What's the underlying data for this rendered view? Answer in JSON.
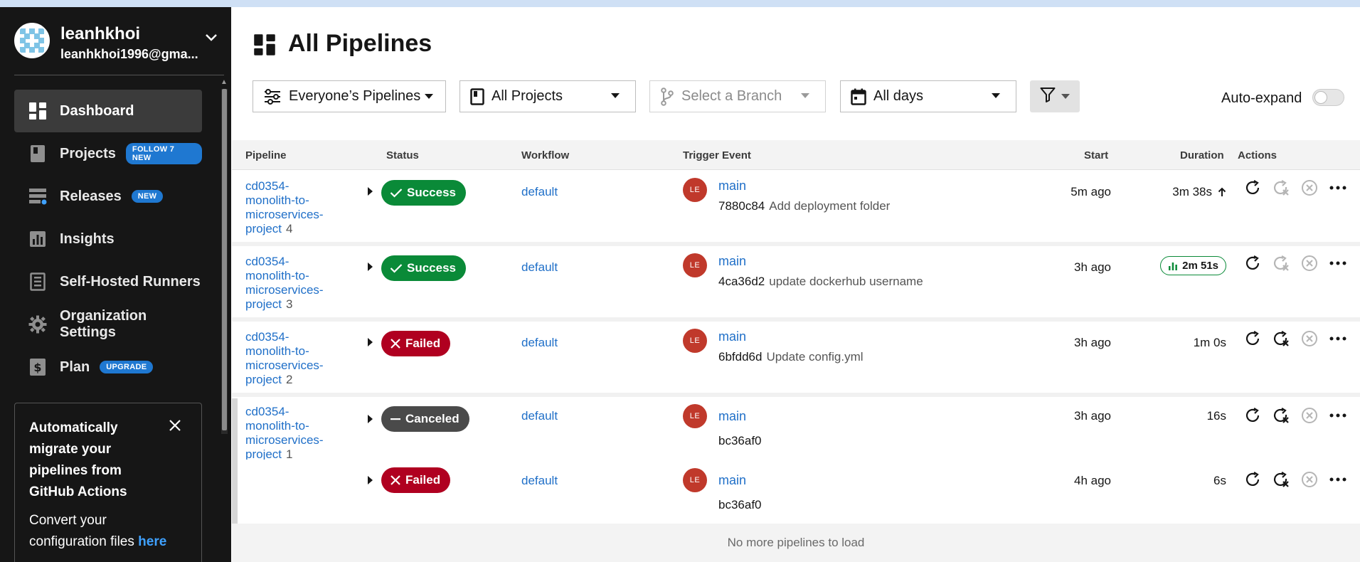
{
  "user": {
    "name": "leanhkhoi",
    "email": "leanhkhoi1996@gma..."
  },
  "sidebar": {
    "items": [
      {
        "label": "Dashboard",
        "icon": "dashboard-icon",
        "active": true,
        "badge": ""
      },
      {
        "label": "Projects",
        "icon": "projects-icon",
        "active": false,
        "badge": "FOLLOW 7 NEW"
      },
      {
        "label": "Releases",
        "icon": "releases-icon",
        "active": false,
        "badge": "NEW"
      },
      {
        "label": "Insights",
        "icon": "insights-icon",
        "active": false,
        "badge": ""
      },
      {
        "label": "Self-Hosted Runners",
        "icon": "runners-icon",
        "active": false,
        "badge": ""
      },
      {
        "label": "Organization Settings",
        "icon": "gear-icon",
        "active": false,
        "badge": ""
      },
      {
        "label": "Plan",
        "icon": "dollar-icon",
        "active": false,
        "badge": "UPGRADE"
      }
    ],
    "promo": {
      "title": "Automatically migrate your pipelines from GitHub Actions",
      "text": "Convert your configuration files ",
      "link": "here"
    }
  },
  "page": {
    "title": "All Pipelines"
  },
  "filters": {
    "pipelines": "Everyone’s Pipelines",
    "projects": "All Projects",
    "branch_placeholder": "Select a Branch",
    "days": "All days",
    "auto_expand": "Auto-expand"
  },
  "table": {
    "headers": {
      "pipeline": "Pipeline",
      "status": "Status",
      "workflow": "Workflow",
      "trigger": "Trigger Event",
      "start": "Start",
      "duration": "Duration",
      "actions": "Actions"
    },
    "rows": [
      {
        "pipeline_lines": [
          "cd0354-",
          "monolith-to-",
          "microservices-",
          "project"
        ],
        "number": "4",
        "status": "Success",
        "workflow": "default",
        "avatar": "LE",
        "branch": "main",
        "commit": "7880c84",
        "message": "Add deployment folder",
        "start": "5m ago",
        "duration": "3m 38s"
      },
      {
        "pipeline_lines": [
          "cd0354-",
          "monolith-to-",
          "microservices-",
          "project"
        ],
        "number": "3",
        "status": "Success",
        "workflow": "default",
        "avatar": "LE",
        "branch": "main",
        "commit": "4ca36d2",
        "message": "update dockerhub username",
        "start": "3h ago",
        "duration": "2m 51s"
      },
      {
        "pipeline_lines": [
          "cd0354-",
          "monolith-to-",
          "microservices-",
          "project"
        ],
        "number": "2",
        "status": "Failed",
        "workflow": "default",
        "avatar": "LE",
        "branch": "main",
        "commit": "6bfdd6d",
        "message": "Update config.yml",
        "start": "3h ago",
        "duration": "1m 0s"
      },
      {
        "pipeline_lines": [
          "cd0354-",
          "monolith-to-",
          "microservices-",
          "project"
        ],
        "number": "1",
        "status": "Canceled",
        "workflow": "default",
        "avatar": "LE",
        "branch": "main",
        "commit": "bc36af0",
        "message": "",
        "start": "3h ago",
        "duration": "16s"
      },
      {
        "pipeline_lines": [],
        "number": "",
        "status": "Failed",
        "workflow": "default",
        "avatar": "LE",
        "branch": "main",
        "commit": "bc36af0",
        "message": "",
        "start": "4h ago",
        "duration": "6s"
      }
    ],
    "footer": "No more pipelines to load"
  },
  "colors": {
    "success": "#0a8a38",
    "failed": "#b00020",
    "canceled": "#4a4a4a",
    "link": "#1f6fc8",
    "badge_blue": "#1f78d1"
  }
}
